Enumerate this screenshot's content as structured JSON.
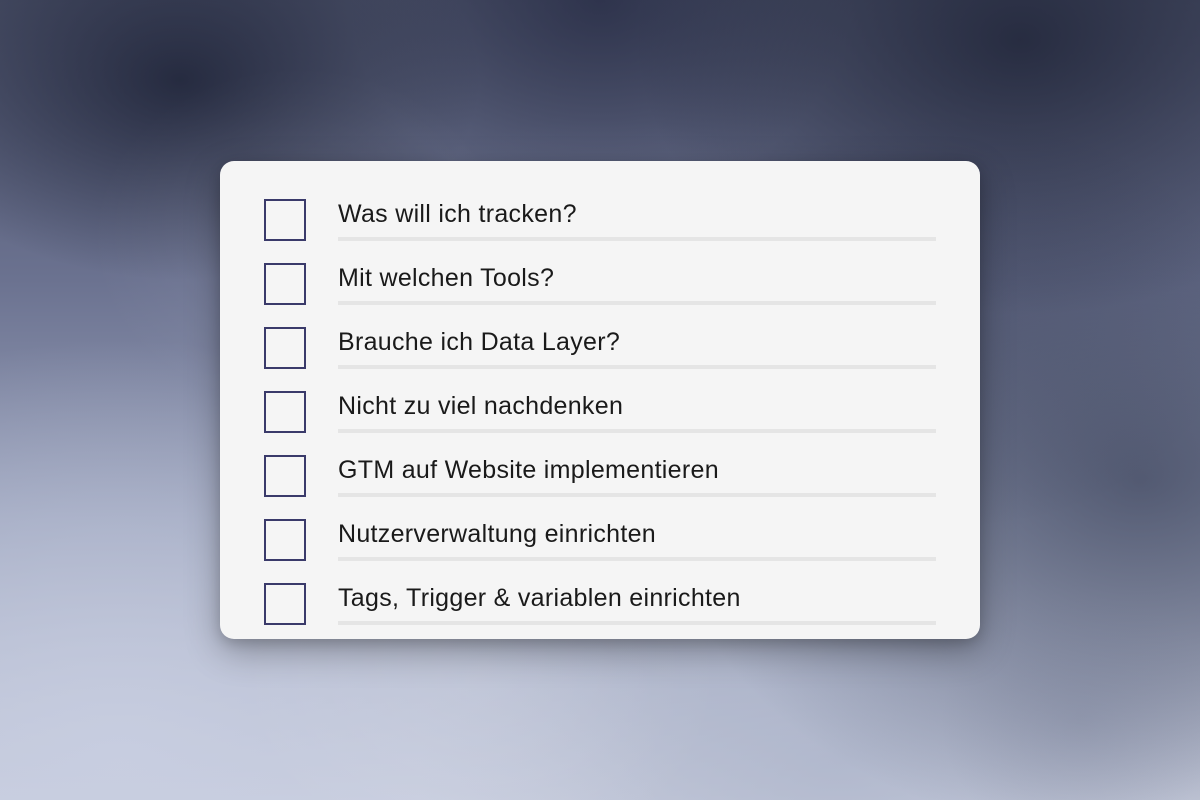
{
  "checklist": {
    "items": [
      {
        "label": "Was will ich tracken?"
      },
      {
        "label": "Mit welchen Tools?"
      },
      {
        "label": "Brauche ich Data Layer?"
      },
      {
        "label": "Nicht zu viel nachdenken"
      },
      {
        "label": "GTM auf Website implementieren"
      },
      {
        "label": "Nutzerverwaltung einrichten"
      },
      {
        "label": "Tags, Trigger & variablen einrichten"
      }
    ]
  },
  "colors": {
    "card_bg": "#f5f5f5",
    "checkbox_border": "#3a3a6a",
    "text": "#1a1a1a",
    "underline": "#e5e5e5"
  }
}
